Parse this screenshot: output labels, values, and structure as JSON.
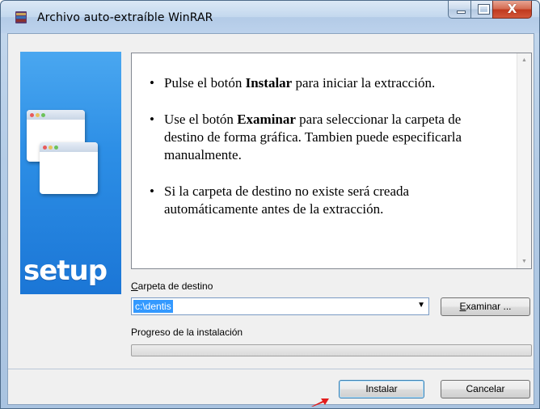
{
  "window": {
    "title": "Archivo auto-extraíble WinRAR",
    "close_glyph": "X"
  },
  "banner": {
    "logo_text": "setup",
    "colors": [
      "#4aa7f0",
      "#1b76d6"
    ]
  },
  "info": {
    "items": [
      {
        "pre": "Pulse el botón ",
        "bold": "Instalar",
        "post": " para iniciar la extracción."
      },
      {
        "pre": "Use el botón ",
        "bold": "Examinar",
        "post": " para seleccionar la carpeta de destino de forma gráfica. Tambien puede especificarla manualmente."
      },
      {
        "pre": "Si la carpeta de destino no existe será creada automáticamente antes de la extracción.",
        "bold": "",
        "post": ""
      }
    ]
  },
  "destination": {
    "label_accel": "C",
    "label_rest": "arpeta de destino",
    "value": "c:\\dentis"
  },
  "browse_button": {
    "accel": "E",
    "rest": "xaminar ..."
  },
  "progress": {
    "label": "Progreso de la instalación",
    "value": 0
  },
  "buttons": {
    "install": "Instalar",
    "cancel": "Cancelar"
  },
  "colors": {
    "accent": "#3399ff",
    "close": "#c0391e"
  }
}
